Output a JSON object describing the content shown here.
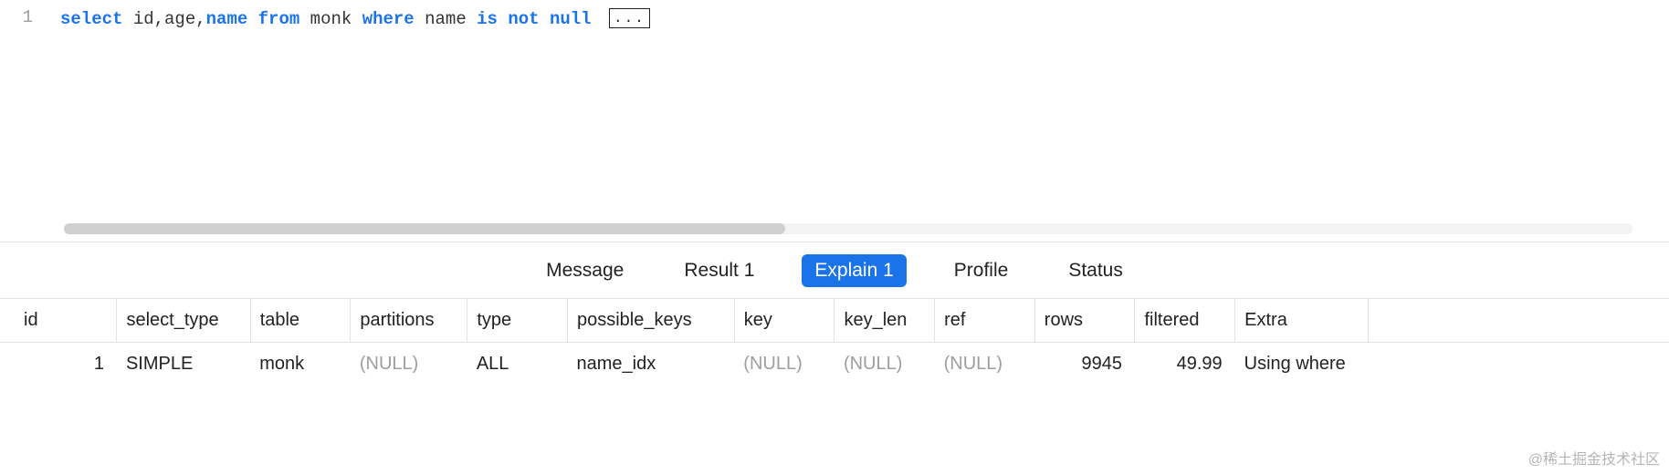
{
  "editor": {
    "line_number": "1",
    "tokens": {
      "select": "select",
      "cols": " id,age,",
      "name": "name",
      "from": " from",
      "table": " monk ",
      "where": "where",
      "sp1": " ",
      "namecol": "name",
      "sp2": " ",
      "is": "is",
      "sp3": " ",
      "not": "not",
      "sp4": " ",
      "null": "null",
      "sp5": " "
    },
    "fold_label": "..."
  },
  "tabs": {
    "message": "Message",
    "result": "Result 1",
    "explain": "Explain 1",
    "profile": "Profile",
    "status": "Status"
  },
  "explain_table": {
    "headers": {
      "id": "id",
      "select_type": "select_type",
      "table": "table",
      "partitions": "partitions",
      "type": "type",
      "possible_keys": "possible_keys",
      "key": "key",
      "key_len": "key_len",
      "ref": "ref",
      "rows": "rows",
      "filtered": "filtered",
      "extra": "Extra"
    },
    "row": {
      "id": "1",
      "select_type": "SIMPLE",
      "table": "monk",
      "partitions": "(NULL)",
      "type": "ALL",
      "possible_keys": "name_idx",
      "key": "(NULL)",
      "key_len": "(NULL)",
      "ref": "(NULL)",
      "rows": "9945",
      "filtered": "49.99",
      "extra": "Using where"
    }
  },
  "watermark": "@稀土掘金技术社区"
}
